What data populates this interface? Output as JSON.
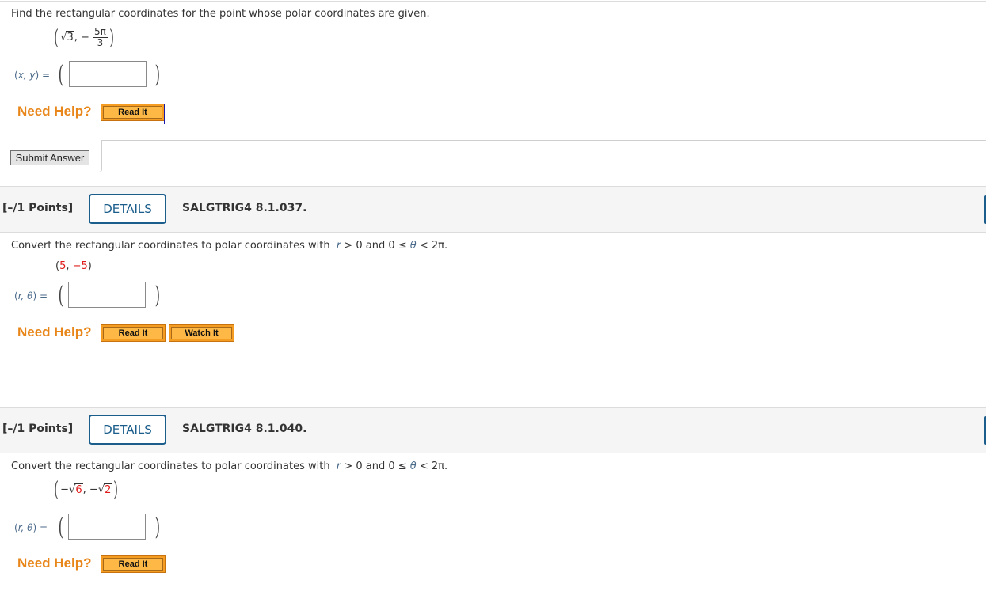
{
  "question1": {
    "prompt": "Find the rectangular coordinates for the point whose polar coordinates are given.",
    "given": {
      "r_radicand": "3",
      "theta_sign": "−",
      "theta_numerator": "5π",
      "theta_denominator": "3"
    },
    "answer_label_vars": "x, y",
    "answer_label_eq": "=",
    "answer_value": "",
    "need_help_label": "Need Help?",
    "help_buttons": [
      {
        "label": "Read It"
      }
    ],
    "submit_label": "Submit Answer"
  },
  "question2": {
    "points": "[–/1 Points]",
    "details_label": "DETAILS",
    "question_id": "SALGTRIG4 8.1.037.",
    "prompt": "Convert the rectangular coordinates to polar coordinates with",
    "condition_r": "r",
    "condition_text1": " > 0 and 0 ≤ ",
    "condition_theta": "θ",
    "condition_text2": " < 2π.",
    "given": {
      "open": "(",
      "x": "5",
      "sep": ", ",
      "y": "−5",
      "close": ")"
    },
    "answer_label_vars": "r, θ",
    "answer_label_eq": "=",
    "answer_value": "",
    "need_help_label": "Need Help?",
    "help_buttons": [
      {
        "label": "Read It"
      },
      {
        "label": "Watch It"
      }
    ]
  },
  "question3": {
    "points": "[–/1 Points]",
    "details_label": "DETAILS",
    "question_id": "SALGTRIG4 8.1.040.",
    "prompt": "Convert the rectangular coordinates to polar coordinates with",
    "condition_r": "r",
    "condition_text1": " > 0 and 0 ≤ ",
    "condition_theta": "θ",
    "condition_text2": " < 2π.",
    "given": {
      "x_sign": "−",
      "x_radicand": "6",
      "sep": ", ",
      "y_sign": "−",
      "y_radicand": "2"
    },
    "answer_label_vars": "r, θ",
    "answer_label_eq": "=",
    "answer_value": "",
    "need_help_label": "Need Help?",
    "help_buttons": [
      {
        "label": "Read It"
      }
    ]
  },
  "colors": {
    "need_help": "#e8861a",
    "help_button": "#fdb846",
    "details_border": "#1b5e8c",
    "given_highlight": "#e01b1b",
    "header_bg": "#f5f5f5"
  }
}
